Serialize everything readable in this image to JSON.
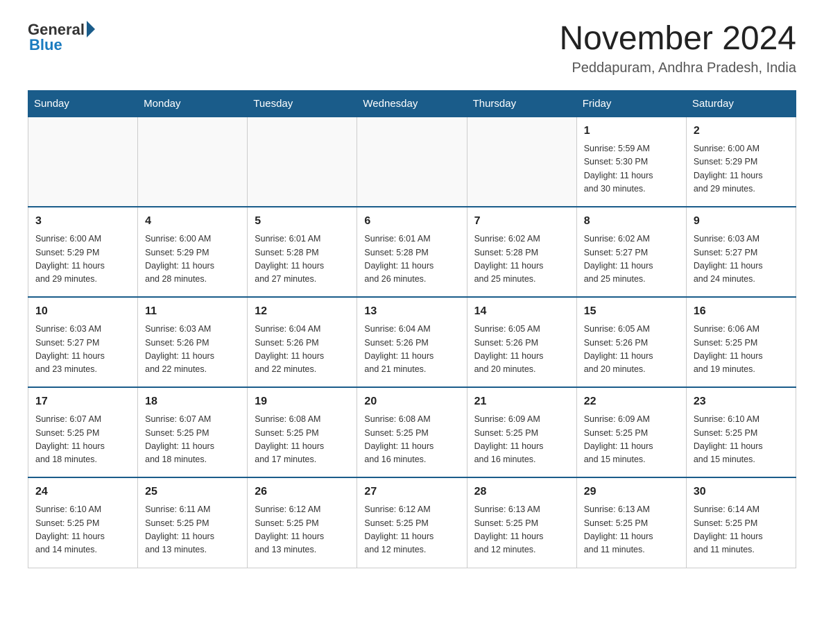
{
  "header": {
    "logo_general": "General",
    "logo_blue": "Blue",
    "title": "November 2024",
    "subtitle": "Peddapuram, Andhra Pradesh, India"
  },
  "weekdays": [
    "Sunday",
    "Monday",
    "Tuesday",
    "Wednesday",
    "Thursday",
    "Friday",
    "Saturday"
  ],
  "weeks": [
    [
      {
        "day": "",
        "info": ""
      },
      {
        "day": "",
        "info": ""
      },
      {
        "day": "",
        "info": ""
      },
      {
        "day": "",
        "info": ""
      },
      {
        "day": "",
        "info": ""
      },
      {
        "day": "1",
        "info": "Sunrise: 5:59 AM\nSunset: 5:30 PM\nDaylight: 11 hours\nand 30 minutes."
      },
      {
        "day": "2",
        "info": "Sunrise: 6:00 AM\nSunset: 5:29 PM\nDaylight: 11 hours\nand 29 minutes."
      }
    ],
    [
      {
        "day": "3",
        "info": "Sunrise: 6:00 AM\nSunset: 5:29 PM\nDaylight: 11 hours\nand 29 minutes."
      },
      {
        "day": "4",
        "info": "Sunrise: 6:00 AM\nSunset: 5:29 PM\nDaylight: 11 hours\nand 28 minutes."
      },
      {
        "day": "5",
        "info": "Sunrise: 6:01 AM\nSunset: 5:28 PM\nDaylight: 11 hours\nand 27 minutes."
      },
      {
        "day": "6",
        "info": "Sunrise: 6:01 AM\nSunset: 5:28 PM\nDaylight: 11 hours\nand 26 minutes."
      },
      {
        "day": "7",
        "info": "Sunrise: 6:02 AM\nSunset: 5:28 PM\nDaylight: 11 hours\nand 25 minutes."
      },
      {
        "day": "8",
        "info": "Sunrise: 6:02 AM\nSunset: 5:27 PM\nDaylight: 11 hours\nand 25 minutes."
      },
      {
        "day": "9",
        "info": "Sunrise: 6:03 AM\nSunset: 5:27 PM\nDaylight: 11 hours\nand 24 minutes."
      }
    ],
    [
      {
        "day": "10",
        "info": "Sunrise: 6:03 AM\nSunset: 5:27 PM\nDaylight: 11 hours\nand 23 minutes."
      },
      {
        "day": "11",
        "info": "Sunrise: 6:03 AM\nSunset: 5:26 PM\nDaylight: 11 hours\nand 22 minutes."
      },
      {
        "day": "12",
        "info": "Sunrise: 6:04 AM\nSunset: 5:26 PM\nDaylight: 11 hours\nand 22 minutes."
      },
      {
        "day": "13",
        "info": "Sunrise: 6:04 AM\nSunset: 5:26 PM\nDaylight: 11 hours\nand 21 minutes."
      },
      {
        "day": "14",
        "info": "Sunrise: 6:05 AM\nSunset: 5:26 PM\nDaylight: 11 hours\nand 20 minutes."
      },
      {
        "day": "15",
        "info": "Sunrise: 6:05 AM\nSunset: 5:26 PM\nDaylight: 11 hours\nand 20 minutes."
      },
      {
        "day": "16",
        "info": "Sunrise: 6:06 AM\nSunset: 5:25 PM\nDaylight: 11 hours\nand 19 minutes."
      }
    ],
    [
      {
        "day": "17",
        "info": "Sunrise: 6:07 AM\nSunset: 5:25 PM\nDaylight: 11 hours\nand 18 minutes."
      },
      {
        "day": "18",
        "info": "Sunrise: 6:07 AM\nSunset: 5:25 PM\nDaylight: 11 hours\nand 18 minutes."
      },
      {
        "day": "19",
        "info": "Sunrise: 6:08 AM\nSunset: 5:25 PM\nDaylight: 11 hours\nand 17 minutes."
      },
      {
        "day": "20",
        "info": "Sunrise: 6:08 AM\nSunset: 5:25 PM\nDaylight: 11 hours\nand 16 minutes."
      },
      {
        "day": "21",
        "info": "Sunrise: 6:09 AM\nSunset: 5:25 PM\nDaylight: 11 hours\nand 16 minutes."
      },
      {
        "day": "22",
        "info": "Sunrise: 6:09 AM\nSunset: 5:25 PM\nDaylight: 11 hours\nand 15 minutes."
      },
      {
        "day": "23",
        "info": "Sunrise: 6:10 AM\nSunset: 5:25 PM\nDaylight: 11 hours\nand 15 minutes."
      }
    ],
    [
      {
        "day": "24",
        "info": "Sunrise: 6:10 AM\nSunset: 5:25 PM\nDaylight: 11 hours\nand 14 minutes."
      },
      {
        "day": "25",
        "info": "Sunrise: 6:11 AM\nSunset: 5:25 PM\nDaylight: 11 hours\nand 13 minutes."
      },
      {
        "day": "26",
        "info": "Sunrise: 6:12 AM\nSunset: 5:25 PM\nDaylight: 11 hours\nand 13 minutes."
      },
      {
        "day": "27",
        "info": "Sunrise: 6:12 AM\nSunset: 5:25 PM\nDaylight: 11 hours\nand 12 minutes."
      },
      {
        "day": "28",
        "info": "Sunrise: 6:13 AM\nSunset: 5:25 PM\nDaylight: 11 hours\nand 12 minutes."
      },
      {
        "day": "29",
        "info": "Sunrise: 6:13 AM\nSunset: 5:25 PM\nDaylight: 11 hours\nand 11 minutes."
      },
      {
        "day": "30",
        "info": "Sunrise: 6:14 AM\nSunset: 5:25 PM\nDaylight: 11 hours\nand 11 minutes."
      }
    ]
  ]
}
